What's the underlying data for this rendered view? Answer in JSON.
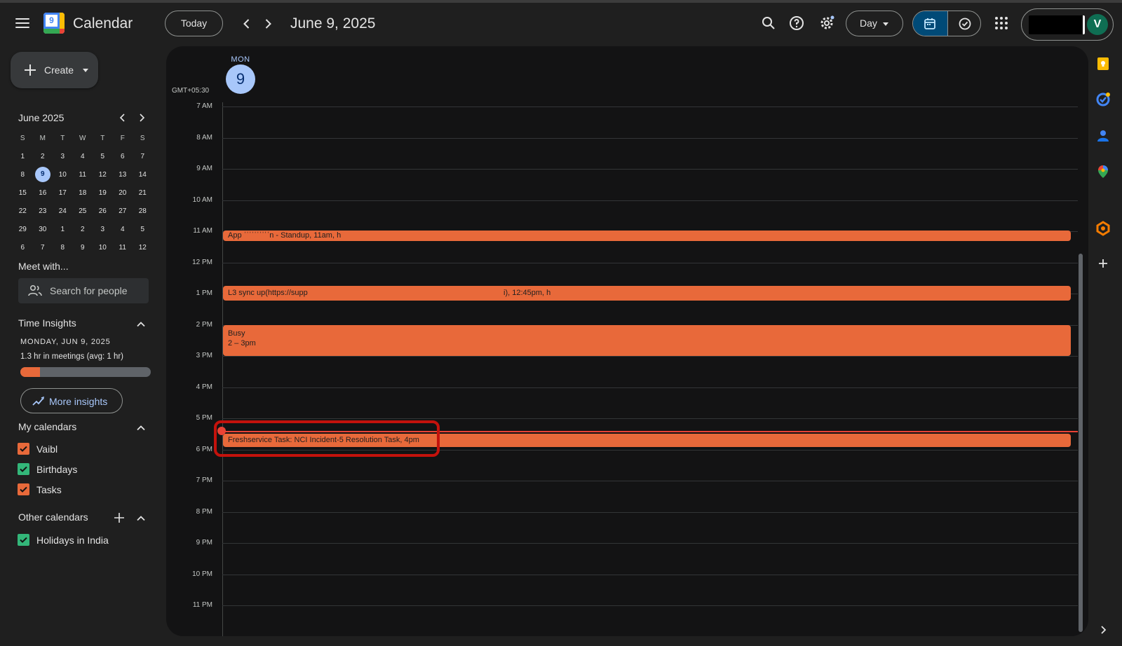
{
  "header": {
    "app_name": "Calendar",
    "logo_number": "9",
    "today_label": "Today",
    "date_title": "June 9, 2025",
    "view_label": "Day",
    "avatar_letter": "V",
    "icons": [
      "menu-icon",
      "search-icon",
      "help-icon",
      "settings-icon",
      "calendar-icon",
      "task-check-icon",
      "apps-grid-icon"
    ]
  },
  "sidebar": {
    "create_label": "Create",
    "mini_calendar": {
      "title": "June 2025",
      "weekdays": [
        "S",
        "M",
        "T",
        "W",
        "T",
        "F",
        "S"
      ],
      "weeks": [
        [
          "1",
          "2",
          "3",
          "4",
          "5",
          "6",
          "7"
        ],
        [
          "8",
          "9",
          "10",
          "11",
          "12",
          "13",
          "14"
        ],
        [
          "15",
          "16",
          "17",
          "18",
          "19",
          "20",
          "21"
        ],
        [
          "22",
          "23",
          "24",
          "25",
          "26",
          "27",
          "28"
        ],
        [
          "29",
          "30",
          "1",
          "2",
          "3",
          "4",
          "5"
        ],
        [
          "6",
          "7",
          "8",
          "9",
          "10",
          "11",
          "12"
        ]
      ],
      "selected_day": "9"
    },
    "meet_with": {
      "title": "Meet with...",
      "placeholder": "Search for people"
    },
    "time_insights": {
      "title": "Time Insights",
      "date": "MONDAY, JUN 9, 2025",
      "meetings_text": "1.3 hr in meetings (avg: 1 hr)",
      "bar_fraction": 0.15,
      "more_label": "More insights"
    },
    "my_calendars": {
      "title": "My calendars",
      "items": [
        {
          "name": "Vaibl",
          "color": "#e8693a"
        },
        {
          "name": "Birthdays",
          "color": "#33b679"
        },
        {
          "name": "Tasks",
          "color": "#e8693a"
        }
      ]
    },
    "other_calendars": {
      "title": "Other calendars",
      "items": [
        {
          "name": "Holidays in India",
          "color": "#33b679"
        }
      ]
    }
  },
  "day_view": {
    "weekday": "MON",
    "day_number": "9",
    "timezone": "GMT+05:30",
    "hours": [
      "7 AM",
      "8 AM",
      "9 AM",
      "10 AM",
      "11 AM",
      "12 PM",
      "1 PM",
      "2 PM",
      "3 PM",
      "4 PM",
      "5 PM",
      "6 PM",
      "7 PM",
      "8 PM",
      "9 PM",
      "10 PM",
      "11 PM"
    ],
    "events": [
      {
        "title": "App ˈˈˈˈˈˈˈˈˈˈn - Standup,",
        "time": "11am, h"
      },
      {
        "title": "L3 sync up(https://supp",
        "time": "i), 12:45pm, h"
      },
      {
        "title": "Busy",
        "time": "2 – 3pm"
      },
      {
        "title": "Freshservice Task: NCI Incident-5 Resolution Task,",
        "time": "4pm"
      }
    ],
    "event_color": "#e8693a",
    "now_line_color": "#ea4335"
  }
}
